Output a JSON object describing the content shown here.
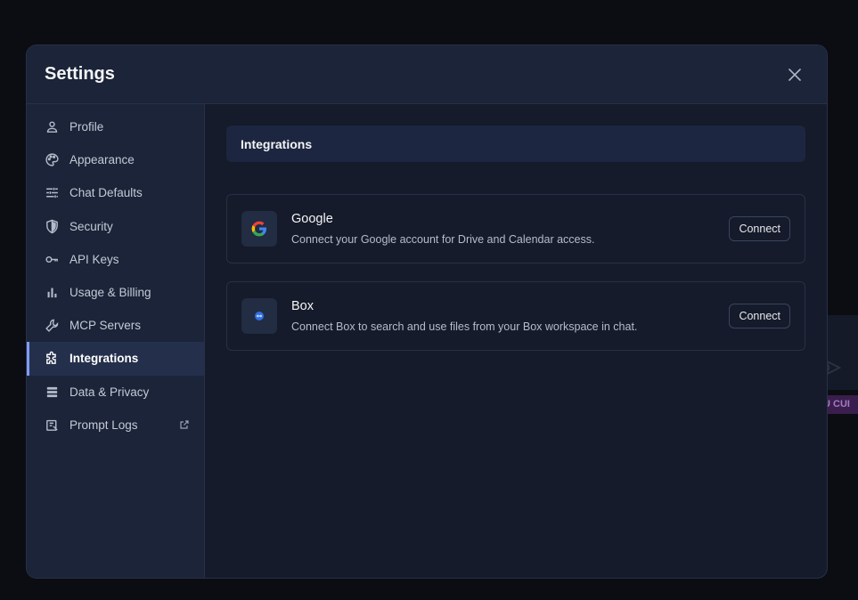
{
  "background": {
    "badge_text": "U CUI"
  },
  "modal": {
    "title": "Settings",
    "close_label": "×"
  },
  "sidebar": {
    "items": [
      {
        "label": "Profile",
        "icon": "person-icon"
      },
      {
        "label": "Appearance",
        "icon": "palette-icon"
      },
      {
        "label": "Chat Defaults",
        "icon": "sliders-icon"
      },
      {
        "label": "Security",
        "icon": "shield-icon"
      },
      {
        "label": "API Keys",
        "icon": "key-icon"
      },
      {
        "label": "Usage & Billing",
        "icon": "bar-chart-icon"
      },
      {
        "label": "MCP Servers",
        "icon": "wrench-icon"
      },
      {
        "label": "Integrations",
        "icon": "puzzle-icon",
        "active": true
      },
      {
        "label": "Data & Privacy",
        "icon": "database-icon"
      },
      {
        "label": "Prompt Logs",
        "icon": "logs-icon",
        "external": true
      }
    ]
  },
  "content": {
    "section_title": "Integrations",
    "integrations": [
      {
        "name": "Google",
        "description": "Connect your Google account for Drive and Calendar access.",
        "button_label": "Connect",
        "icon": "google-logo-icon"
      },
      {
        "name": "Box",
        "description": "Connect Box to search and use files from your Box workspace in chat.",
        "button_label": "Connect",
        "icon": "box-logo-icon"
      }
    ]
  },
  "colors": {
    "accent": "#7f9cf5",
    "background": "#0b0d13",
    "modal_bg": "#151b2a",
    "sidebar_bg": "#1b2438",
    "active_item_bg": "#24304b"
  }
}
